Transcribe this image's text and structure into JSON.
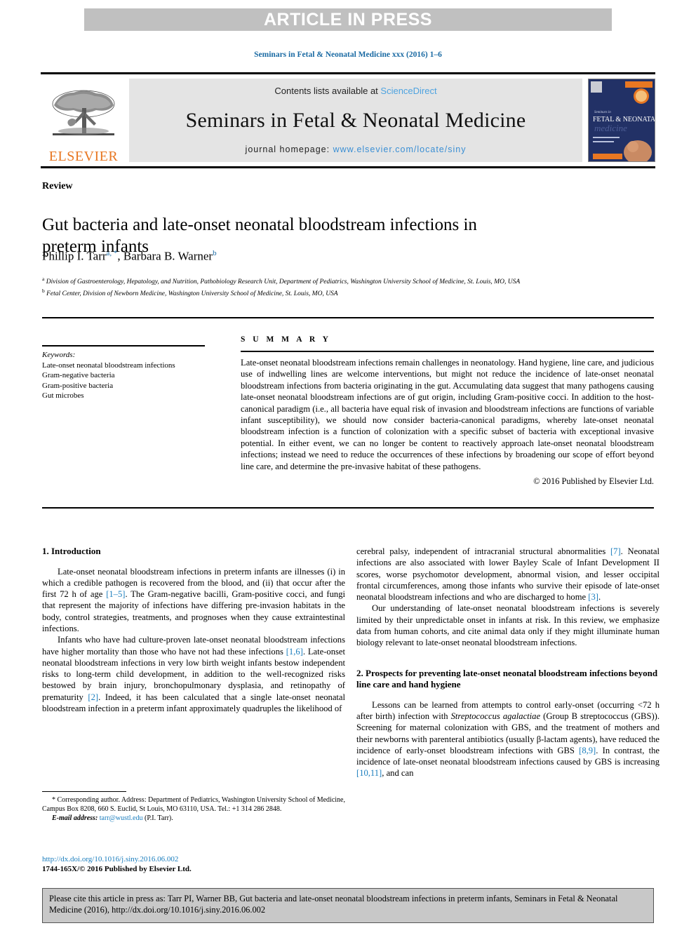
{
  "banner": {
    "label": "ARTICLE IN PRESS"
  },
  "running_head": "Seminars in Fetal & Neonatal Medicine xxx (2016) 1–6",
  "masthead": {
    "contents_prefix": "Contents lists available at ",
    "contents_link": "ScienceDirect",
    "journal_title": "Seminars in Fetal & Neonatal Medicine",
    "homepage_prefix": "journal homepage: ",
    "homepage_url": "www.elsevier.com/locate/siny",
    "publisher": "ELSEVIER",
    "cover_line1": "Seminars in",
    "cover_line2": "FETAL & NEONATAL",
    "cover_line3": "medicine"
  },
  "article": {
    "type": "Review",
    "title": "Gut bacteria and late-onset neonatal bloodstream infections in preterm infants",
    "authors": "Phillip I. Tarr",
    "author_sup_1": "a, *",
    "authors_2": ", Barbara B. Warner",
    "author_sup_2": "b",
    "affiliation_a_sup": "a",
    "affiliation_a": "Division of Gastroenterology, Hepatology, and Nutrition, Pathobiology Research Unit, Department of Pediatrics, Washington University School of Medicine, St. Louis, MO, USA",
    "affiliation_b_sup": "b",
    "affiliation_b": "Fetal Center, Division of Newborn Medicine, Washington University School of Medicine, St. Louis, MO, USA"
  },
  "keywords": {
    "heading": "Keywords:",
    "items": [
      "Late-onset neonatal bloodstream infections",
      "Gram-negative bacteria",
      "Gram-positive bacteria",
      "Gut microbes"
    ]
  },
  "summary": {
    "heading": "S U M M A R Y",
    "body": "Late-onset neonatal bloodstream infections remain challenges in neonatology. Hand hygiene, line care, and judicious use of indwelling lines are welcome interventions, but might not reduce the incidence of late-onset neonatal bloodstream infections from bacteria originating in the gut. Accumulating data suggest that many pathogens causing late-onset neonatal bloodstream infections are of gut origin, including Gram-positive cocci. In addition to the host-canonical paradigm (i.e., all bacteria have equal risk of invasion and bloodstream infections are functions of variable infant susceptibility), we should now consider bacteria-canonical paradigms, whereby late-onset neonatal bloodstream infection is a function of colonization with a specific subset of bacteria with exceptional invasive potential. In either event, we can no longer be content to reactively approach late-onset neonatal bloodstream infections; instead we need to reduce the occurrences of these infections by broadening our scope of effort beyond line care, and determine the pre-invasive habitat of these pathogens.",
    "copyright": "© 2016 Published by Elsevier Ltd."
  },
  "sections": {
    "intro_heading": "1. Introduction",
    "intro_p1_a": "Late-onset neonatal bloodstream infections in preterm infants are illnesses (i) in which a credible pathogen is recovered from the blood, and (ii) that occur after the first 72 h of age ",
    "intro_p1_ref": "[1–5]",
    "intro_p1_b": ". The Gram-negative bacilli, Gram-positive cocci, and fungi that represent the majority of infections have differing pre-invasion habitats in the body, control strategies, treatments, and prognoses when they cause extraintestinal infections.",
    "intro_p2_a": "Infants who have had culture-proven late-onset neonatal bloodstream infections have higher mortality than those who have not had these infections ",
    "intro_p2_ref1": "[1,6]",
    "intro_p2_b": ". Late-onset neonatal bloodstream infections in very low birth weight infants bestow independent risks to long-term child development, in addition to the well-recognized risks bestowed by brain injury, bronchopulmonary dysplasia, and retinopathy of prematurity ",
    "intro_p2_ref2": "[2]",
    "intro_p2_c": ". Indeed, it has been calculated that a single late-onset neonatal bloodstream infection in a preterm infant approximately quadruples the likelihood of",
    "right_p1_a": "cerebral palsy, independent of intracranial structural abnormalities ",
    "right_p1_ref1": "[7]",
    "right_p1_b": ". Neonatal infections are also associated with lower Bayley Scale of Infant Development II scores, worse psychomotor development, abnormal vision, and lesser occipital frontal circumferences, among those infants who survive their episode of late-onset neonatal bloodstream infections and who are discharged to home ",
    "right_p1_ref2": "[3]",
    "right_p1_c": ".",
    "right_p2": "Our understanding of late-onset neonatal bloodstream infections is severely limited by their unpredictable onset in infants at risk. In this review, we emphasize data from human cohorts, and cite animal data only if they might illuminate human biology relevant to late-onset neonatal bloodstream infections.",
    "sec2_heading": "2. Prospects for preventing late-onset neonatal bloodstream infections beyond line care and hand hygiene",
    "sec2_p1_a": "Lessons can be learned from attempts to control early-onset (occurring <72 h after birth) infection with ",
    "sec2_p1_it1": "Streptococcus agalactiae",
    "sec2_p1_b": " (Group B streptococcus (GBS)). Screening for maternal colonization with GBS, and the treatment of mothers and their newborns with parenteral antibiotics (usually β-lactam agents), have reduced the incidence of early-onset bloodstream infections with GBS ",
    "sec2_p1_ref1": "[8,9]",
    "sec2_p1_c": ". In contrast, the incidence of late-onset neonatal bloodstream infections caused by GBS is increasing ",
    "sec2_p1_ref2": "[10,11]",
    "sec2_p1_d": ", and can"
  },
  "footnote": {
    "corresponding": "* Corresponding author. Address: Department of Pediatrics, Washington University School of Medicine, Campus Box 8208, 660 S. Euclid, St Louis, MO 63110, USA. Tel.: +1 314 286 2848.",
    "email_label": "E-mail address:",
    "email": "tarr@wustl.edu",
    "email_owner": "(P.I. Tarr)."
  },
  "doi": {
    "link": "http://dx.doi.org/10.1016/j.siny.2016.06.002",
    "issn": "1744-165X/© 2016 Published by Elsevier Ltd."
  },
  "citation_footer": "Please cite this article in press as: Tarr PI, Warner BB, Gut bacteria and late-onset neonatal bloodstream infections in preterm infants, Seminars in Fetal & Neonatal Medicine (2016), http://dx.doi.org/10.1016/j.siny.2016.06.002",
  "colors": {
    "link_blue": "#1a7dbd",
    "elsevier_orange": "#E87722",
    "banner_grey": "#c0c0c0",
    "masthead_grey": "#e4e4e4",
    "cite_box_grey": "#c8c8c8"
  }
}
